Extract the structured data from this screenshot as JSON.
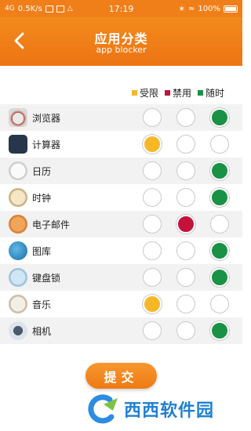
{
  "status_bar": {
    "network": "4G",
    "speed": "0.5K/s",
    "time": "17:19",
    "battery": "100%"
  },
  "header": {
    "title": "应用分类",
    "subtitle": "app blocker"
  },
  "legend": {
    "items": [
      {
        "label": "受限",
        "color": "#f7b828"
      },
      {
        "label": "禁用",
        "color": "#c4133a"
      },
      {
        "label": "随时",
        "color": "#1a9245"
      }
    ]
  },
  "apps": [
    {
      "label": "浏览器",
      "icon": "browser-icon",
      "selected": "anytime"
    },
    {
      "label": "计算器",
      "icon": "calculator-icon",
      "selected": "limited"
    },
    {
      "label": "日历",
      "icon": "calendar-icon",
      "selected": "anytime"
    },
    {
      "label": "时钟",
      "icon": "clock-icon",
      "selected": "anytime"
    },
    {
      "label": "电子邮件",
      "icon": "email-icon",
      "selected": "blocked"
    },
    {
      "label": "图库",
      "icon": "gallery-icon",
      "selected": "anytime"
    },
    {
      "label": "键盘锁",
      "icon": "keyguard-icon",
      "selected": "anytime"
    },
    {
      "label": "音乐",
      "icon": "music-icon",
      "selected": "limited"
    },
    {
      "label": "相机",
      "icon": "camera-icon",
      "selected": "anytime"
    }
  ],
  "submit_label": "提交",
  "watermark": "西西软件园"
}
